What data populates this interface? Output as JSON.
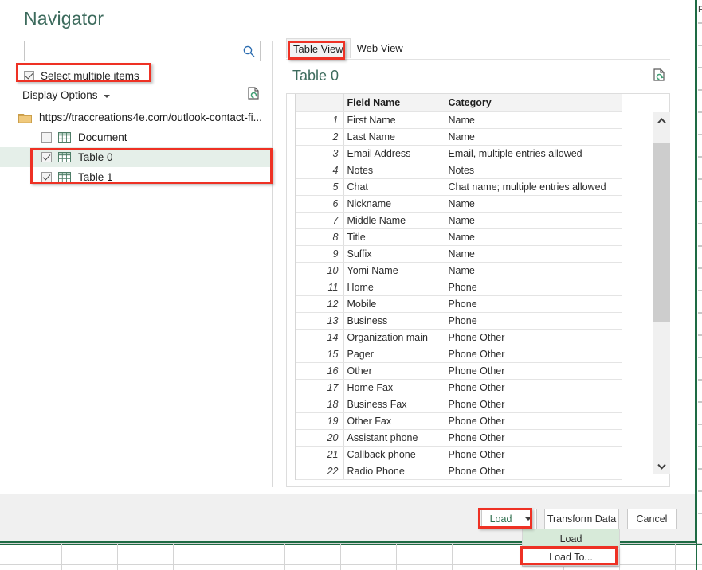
{
  "dialog": {
    "title": "Navigator"
  },
  "search": {
    "value": "",
    "placeholder": "",
    "icon": "search-icon"
  },
  "left_pane": {
    "select_multiple_label": "Select multiple items",
    "select_multiple_checked": true,
    "display_options_label": "Display Options",
    "refresh_icon": "refresh-document-icon",
    "tree": {
      "root": {
        "label": "https://traccreations4e.com/outlook-contact-fi...",
        "icon": "folder-icon",
        "expanded": true
      },
      "items": [
        {
          "label": "Document",
          "icon": "grid-icon",
          "checked": false,
          "selected": false
        },
        {
          "label": "Table 0",
          "icon": "grid-icon",
          "checked": true,
          "selected": true
        },
        {
          "label": "Table 1",
          "icon": "grid-icon",
          "checked": true,
          "selected": false
        }
      ]
    }
  },
  "right_pane": {
    "tabs": [
      {
        "label": "Table View",
        "active": true
      },
      {
        "label": "Web View",
        "active": false
      }
    ],
    "preview_title": "Table 0",
    "refresh_icon": "refresh-document-icon",
    "table": {
      "columns": [
        "",
        "Field Name",
        "Category"
      ],
      "rows": [
        {
          "n": "1",
          "field": "First Name",
          "category": "Name"
        },
        {
          "n": "2",
          "field": "Last Name",
          "category": "Name"
        },
        {
          "n": "3",
          "field": "Email Address",
          "category": "Email, multiple entries allowed"
        },
        {
          "n": "4",
          "field": "Notes",
          "category": "Notes"
        },
        {
          "n": "5",
          "field": "Chat",
          "category": "Chat name;  multiple entries allowed"
        },
        {
          "n": "6",
          "field": "Nickname",
          "category": "Name"
        },
        {
          "n": "7",
          "field": "Middle Name",
          "category": "Name"
        },
        {
          "n": "8",
          "field": "Title",
          "category": "Name"
        },
        {
          "n": "9",
          "field": "Suffix",
          "category": "Name"
        },
        {
          "n": "10",
          "field": "Yomi Name",
          "category": "Name"
        },
        {
          "n": "11",
          "field": "Home",
          "category": "Phone"
        },
        {
          "n": "12",
          "field": "Mobile",
          "category": "Phone"
        },
        {
          "n": "13",
          "field": "Business",
          "category": "Phone"
        },
        {
          "n": "14",
          "field": "Organization main",
          "category": "Phone Other"
        },
        {
          "n": "15",
          "field": "Pager",
          "category": "Phone Other"
        },
        {
          "n": "16",
          "field": "Other",
          "category": "Phone Other"
        },
        {
          "n": "17",
          "field": "Home Fax",
          "category": "Phone Other"
        },
        {
          "n": "18",
          "field": "Business Fax",
          "category": "Phone Other"
        },
        {
          "n": "19",
          "field": "Other Fax",
          "category": "Phone Other"
        },
        {
          "n": "20",
          "field": "Assistant phone",
          "category": "Phone Other"
        },
        {
          "n": "21",
          "field": "Callback phone",
          "category": "Phone Other"
        },
        {
          "n": "22",
          "field": "Radio Phone",
          "category": "Phone Other"
        }
      ]
    },
    "scrollbar": {
      "up_arrow": "chevron-up-icon",
      "down_arrow": "chevron-down-icon"
    }
  },
  "footer": {
    "load_label": "Load",
    "load_caret": "chevron-down-icon",
    "transform_label": "Transform Data",
    "cancel_label": "Cancel"
  },
  "load_menu": {
    "items": [
      {
        "label": "Load",
        "hover": true
      },
      {
        "label": "Load To...",
        "hover": false
      }
    ]
  },
  "colors": {
    "title_green": "#3d6b5d",
    "annotation_red": "#ee3124",
    "selection_green": "#e5efe9",
    "menu_hover_green": "#d7ead9",
    "excel_border_green": "#1e6b44",
    "search_icon_blue": "#2b6cb0"
  }
}
